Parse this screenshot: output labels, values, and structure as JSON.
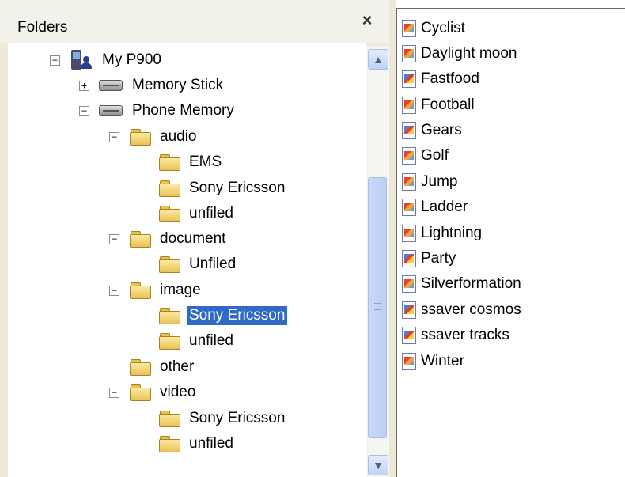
{
  "folders_pane": {
    "title": "Folders",
    "close_symbol": "×"
  },
  "tree": [
    {
      "id": "my-p900",
      "label": "My P900",
      "icon": "phone-device-icon",
      "expander": "minus"
    },
    {
      "id": "memory-stick",
      "label": "Memory Stick",
      "icon": "drive-icon",
      "expander": "plus"
    },
    {
      "id": "phone-memory",
      "label": "Phone Memory",
      "icon": "drive-icon",
      "expander": "minus"
    },
    {
      "id": "audio",
      "label": "audio",
      "icon": "folder-icon",
      "expander": "minus"
    },
    {
      "id": "audio-ems",
      "label": "EMS",
      "icon": "folder-icon",
      "expander": ""
    },
    {
      "id": "audio-sony-ericsson",
      "label": "Sony Ericsson",
      "icon": "folder-icon",
      "expander": ""
    },
    {
      "id": "audio-unfiled",
      "label": "unfiled",
      "icon": "folder-icon",
      "expander": ""
    },
    {
      "id": "document",
      "label": "document",
      "icon": "folder-icon",
      "expander": "minus"
    },
    {
      "id": "document-unfiled",
      "label": "Unfiled",
      "icon": "folder-icon",
      "expander": ""
    },
    {
      "id": "image",
      "label": "image",
      "icon": "folder-icon",
      "expander": "minus"
    },
    {
      "id": "image-sony-ericsson",
      "label": "Sony Ericsson",
      "icon": "folder-icon",
      "expander": "",
      "selected": true
    },
    {
      "id": "image-unfiled",
      "label": "unfiled",
      "icon": "folder-icon",
      "expander": ""
    },
    {
      "id": "other",
      "label": "other",
      "icon": "folder-icon",
      "expander": ""
    },
    {
      "id": "video",
      "label": "video",
      "icon": "folder-icon",
      "expander": "minus"
    },
    {
      "id": "video-sony-ericsson",
      "label": "Sony Ericsson",
      "icon": "folder-icon",
      "expander": ""
    },
    {
      "id": "video-unfiled",
      "label": "unfiled",
      "icon": "folder-icon",
      "expander": ""
    }
  ],
  "expander_symbols": {
    "minus": "−",
    "plus": "+"
  },
  "scrollbar": {
    "up_symbol": "▲",
    "down_symbol": "▼"
  },
  "files": [
    {
      "name": "Cyclist",
      "icon": "image-file-icon"
    },
    {
      "name": "Daylight moon",
      "icon": "image-file-icon"
    },
    {
      "name": "Fastfood",
      "icon": "image-file-icon"
    },
    {
      "name": "Football",
      "icon": "image-file-icon"
    },
    {
      "name": "Gears",
      "icon": "image-file-icon"
    },
    {
      "name": "Golf",
      "icon": "image-file-icon"
    },
    {
      "name": "Jump",
      "icon": "image-file-icon"
    },
    {
      "name": "Ladder",
      "icon": "image-file-icon"
    },
    {
      "name": "Lightning",
      "icon": "image-file-icon"
    },
    {
      "name": "Party",
      "icon": "image-file-icon"
    },
    {
      "name": "Silverformation",
      "icon": "image-file-icon"
    },
    {
      "name": "ssaver cosmos",
      "icon": "image-file-icon"
    },
    {
      "name": "ssaver tracks",
      "icon": "image-file-icon"
    },
    {
      "name": "Winter",
      "icon": "image-file-icon"
    }
  ],
  "colors": {
    "selection": "#316ac5",
    "pane_background": "#ece9d8",
    "scrollbar_accent": "#c0d3f7"
  }
}
